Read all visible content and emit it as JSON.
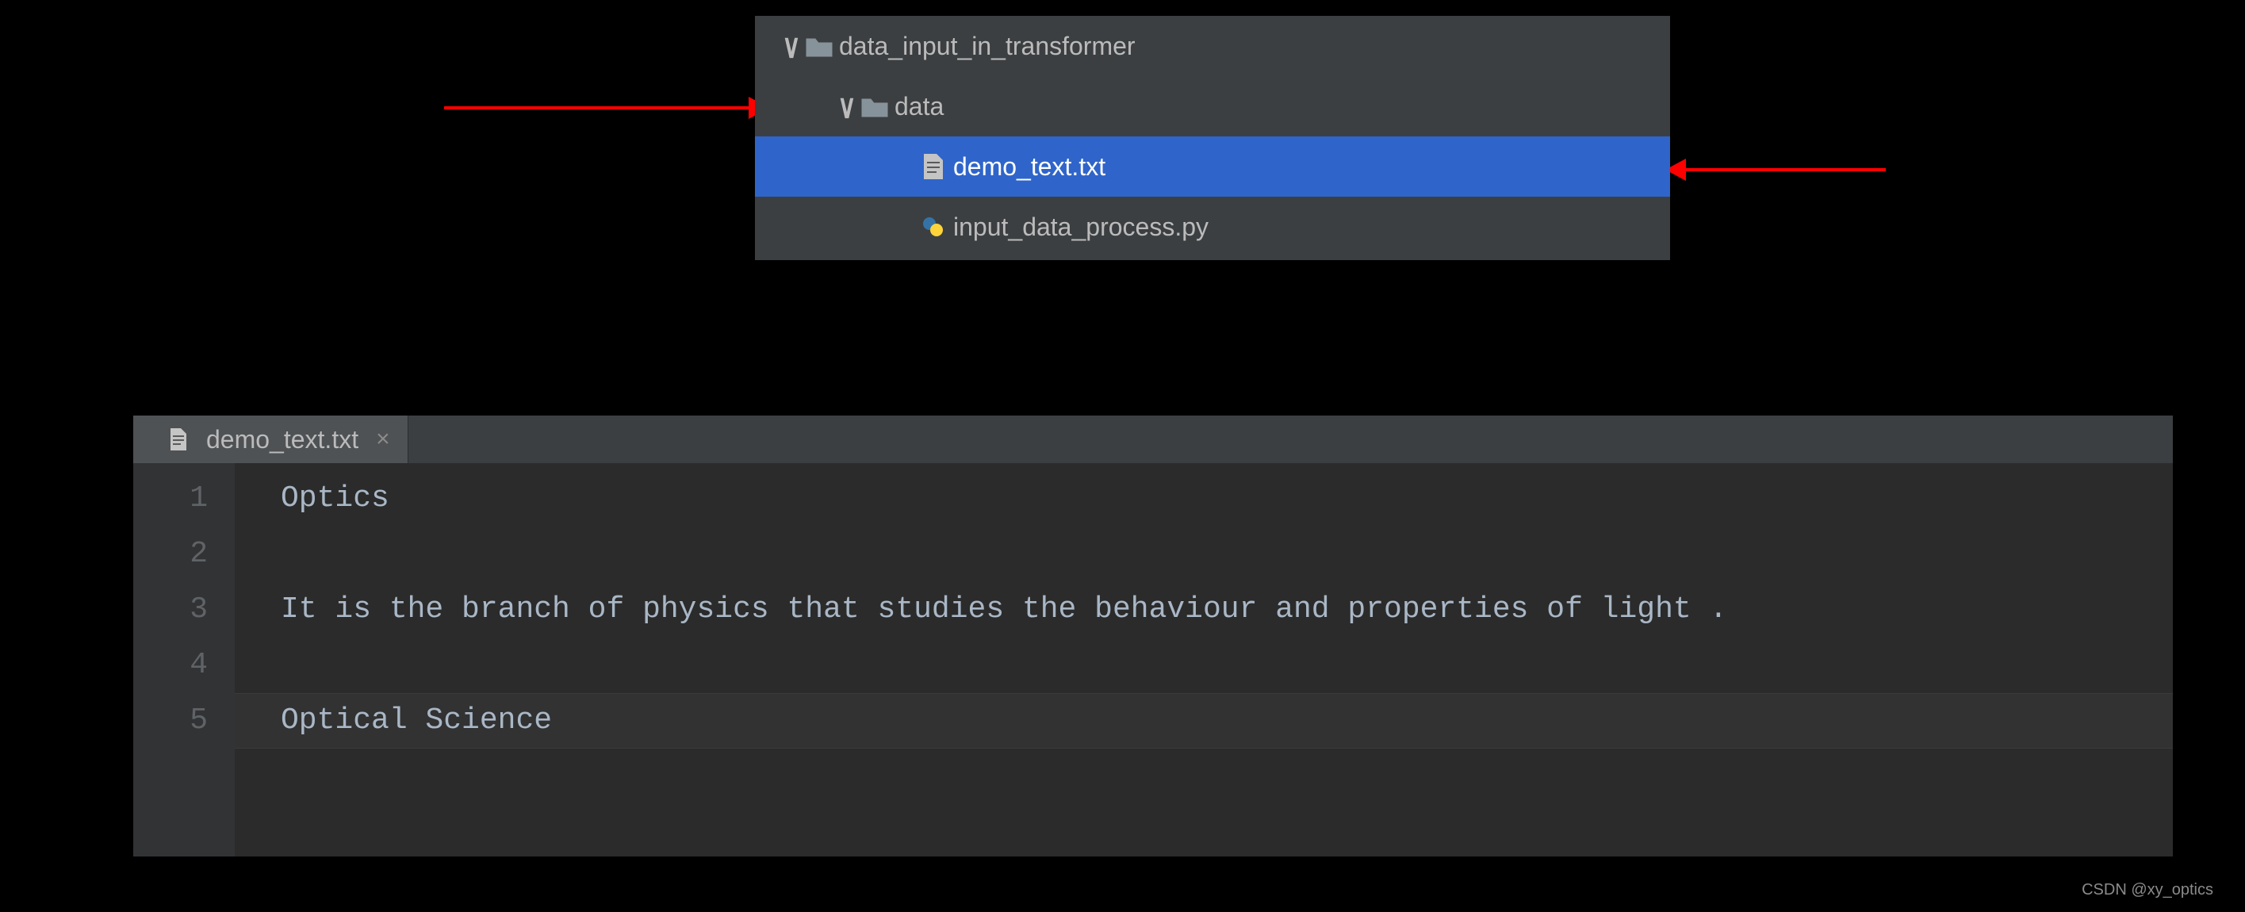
{
  "tree": {
    "root": {
      "label": "data_input_in_transformer",
      "expanded": true
    },
    "child": {
      "label": "data",
      "expanded": true
    },
    "file_selected": {
      "label": "demo_text.txt"
    },
    "file_py": {
      "label": "input_data_process.py"
    }
  },
  "editor": {
    "tab": {
      "label": "demo_text.txt"
    },
    "lines": {
      "1": "Optics",
      "2": "",
      "3": "It is the branch of physics that studies the behaviour and properties of light .",
      "4": "",
      "5": "Optical Science"
    },
    "line_numbers": {
      "1": "1",
      "2": "2",
      "3": "3",
      "4": "4",
      "5": "5"
    }
  },
  "watermark": "CSDN @xy_optics"
}
